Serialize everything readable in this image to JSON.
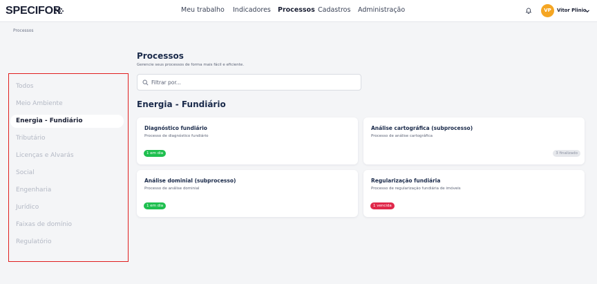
{
  "app": {
    "logo": "SPECIFOR"
  },
  "nav": {
    "items": [
      "Meu trabalho",
      "Indicadores",
      "Processos",
      "Cadastros",
      "Administração"
    ],
    "active": "Processos"
  },
  "user": {
    "initials": "VP",
    "name": "Vitor Plinio",
    "avatar_color": "#f5a623"
  },
  "breadcrumb": "Processos",
  "sidebar": {
    "items": [
      "Todos",
      "Meio Ambiente",
      "Energia - Fundiário",
      "Tributário",
      "Licenças e Alvarás",
      "Social",
      "Engenharia",
      "Jurídico",
      "Faixas de domínio",
      "Regulatório"
    ],
    "active": "Energia - Fundiário"
  },
  "main": {
    "title": "Processos",
    "subtitle": "Gerencie seus processos de forma mais fácil e eficiente.",
    "filter_placeholder": "Filtrar por...",
    "section": "Energia - Fundiário",
    "cards": [
      {
        "title": "Diagnóstico fundiário",
        "subtitle": "Processo de diagnóstico fundiário",
        "badge": "1 em dia",
        "badge_status": "green"
      },
      {
        "title": "Análise cartográfica (subprocesso)",
        "subtitle": "Processo de análise cartográfica",
        "badge": "3 finalizado",
        "badge_status": "gray"
      },
      {
        "title": "Análise dominial (subprocesso)",
        "subtitle": "Processo de análise dominial",
        "badge": "1 em dia",
        "badge_status": "green"
      },
      {
        "title": "Regularização fundiária",
        "subtitle": "Processo de regularização fundiária de imóveis",
        "badge": "1 vencida",
        "badge_status": "red"
      }
    ]
  },
  "colors": {
    "accent_green": "#1fbf4f",
    "accent_red": "#e0284a",
    "highlight_border": "#e01d1d"
  }
}
